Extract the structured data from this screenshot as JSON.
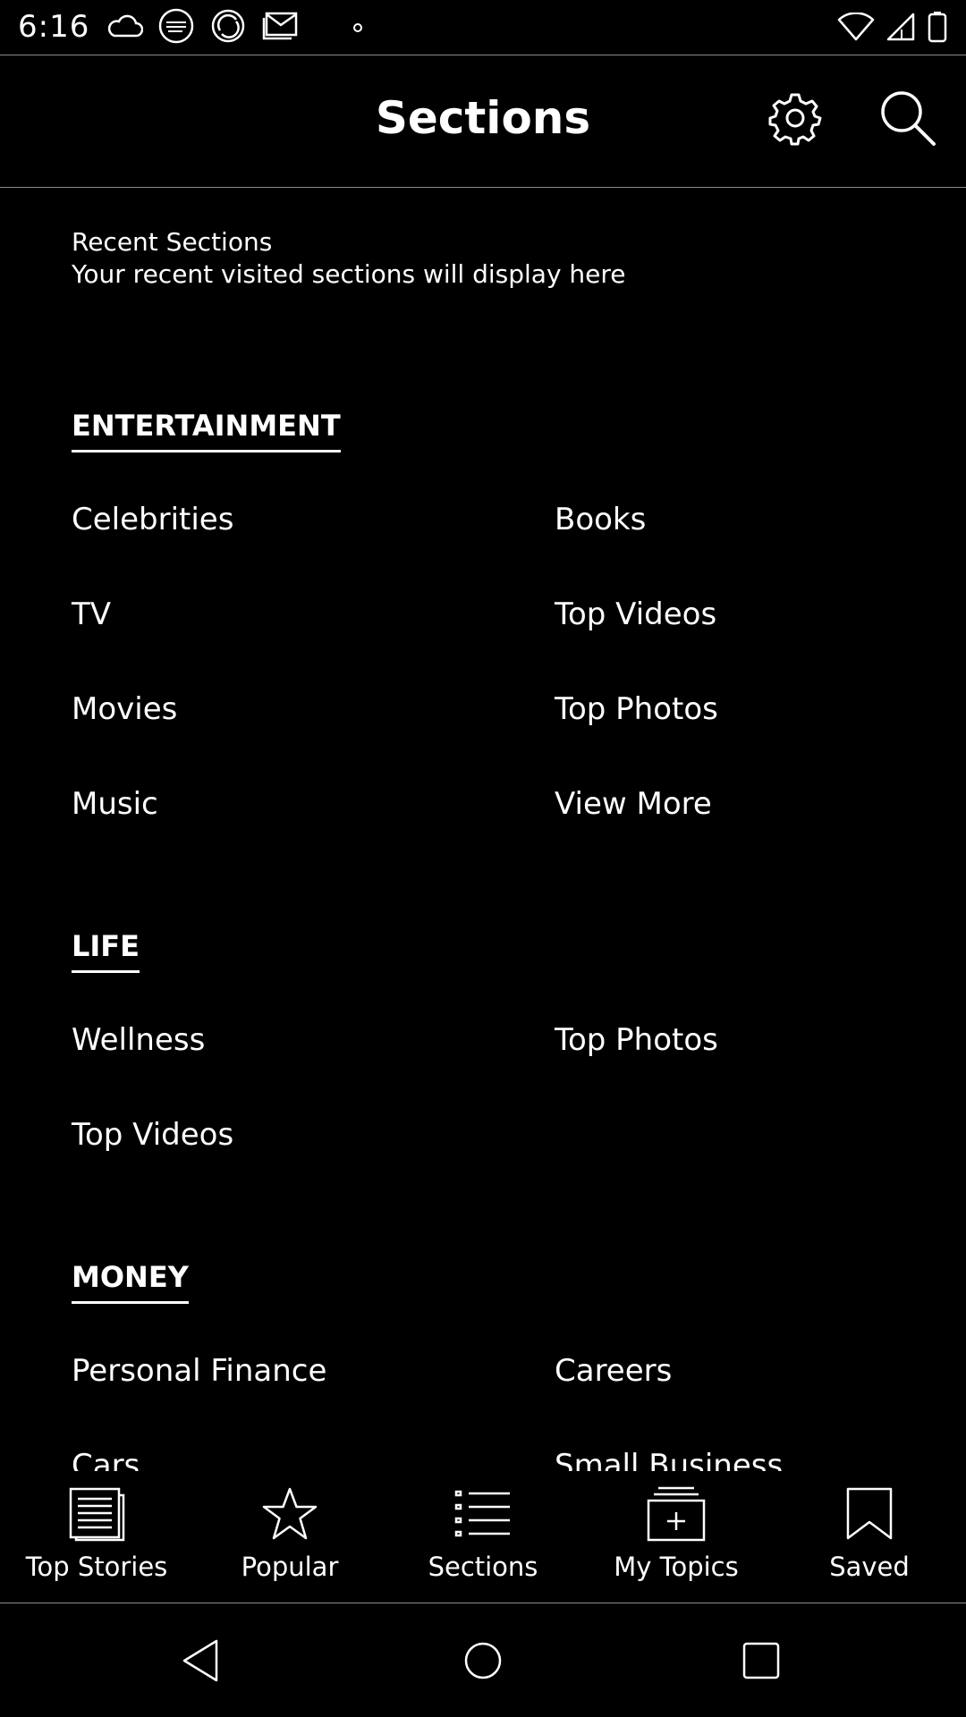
{
  "status_bar": {
    "time": "6:16",
    "left_icons": [
      "cloud-icon",
      "news-app-icon",
      "sync-app-icon",
      "mail-icon",
      "dot-icon"
    ],
    "right_icons": [
      "wifi-icon",
      "signal-icon",
      "battery-icon"
    ]
  },
  "header": {
    "title": "Sections",
    "settings_icon": "gear-icon",
    "search_icon": "search-icon"
  },
  "recent": {
    "title": "Recent Sections",
    "subtitle": "Your recent visited sections will display here"
  },
  "sections": [
    {
      "heading": "ENTERTAINMENT",
      "items": [
        "Celebrities",
        "Books",
        "TV",
        "Top Videos",
        "Movies",
        "Top Photos",
        "Music",
        "View More"
      ]
    },
    {
      "heading": "LIFE",
      "items": [
        "Wellness",
        "Top Photos",
        "Top Videos"
      ]
    },
    {
      "heading": "MONEY",
      "items": [
        "Personal Finance",
        "Careers",
        "Cars",
        "Small Business"
      ]
    }
  ],
  "bottom_nav": {
    "items": [
      {
        "label": "Top Stories",
        "icon": "newspaper-icon"
      },
      {
        "label": "Popular",
        "icon": "star-icon"
      },
      {
        "label": "Sections",
        "icon": "list-icon"
      },
      {
        "label": "My Topics",
        "icon": "add-folder-icon"
      },
      {
        "label": "Saved",
        "icon": "bookmark-icon"
      }
    ]
  },
  "system_nav": {
    "back_icon": "back-triangle-icon",
    "home_icon": "home-circle-icon",
    "recents_icon": "recents-square-icon"
  },
  "colors": {
    "background": "#000000",
    "foreground": "#ffffff",
    "divider": "#8a8a8a"
  }
}
